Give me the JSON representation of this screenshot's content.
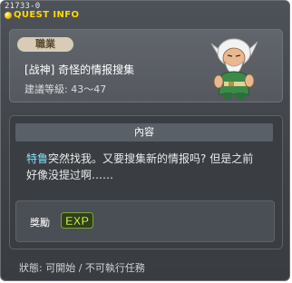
{
  "window": {
    "quest_id": "21733-0",
    "title": "QUEST INFO"
  },
  "header": {
    "job_badge": "職業",
    "quest_name": "[战神] 奇怪的情报搜集",
    "level_range": "建議等級: 43～47"
  },
  "content": {
    "section_title": "內容",
    "npc_name": "特鲁",
    "body": "突然找我。又要搜集新的情报吗? 但是之前好像没提过啊……"
  },
  "reward": {
    "label": "獎勵",
    "exp_text": "EXP"
  },
  "status": {
    "text": "狀態:  可開始 / 不可執行任務"
  },
  "colors": {
    "title": "#ffd800",
    "npc_name": "#7ee3ff",
    "exp_fill": "#c8f34b"
  },
  "icons": {
    "title_dot": "quest-dot-icon",
    "npc": "npc-portrait",
    "exp": "exp-icon"
  }
}
